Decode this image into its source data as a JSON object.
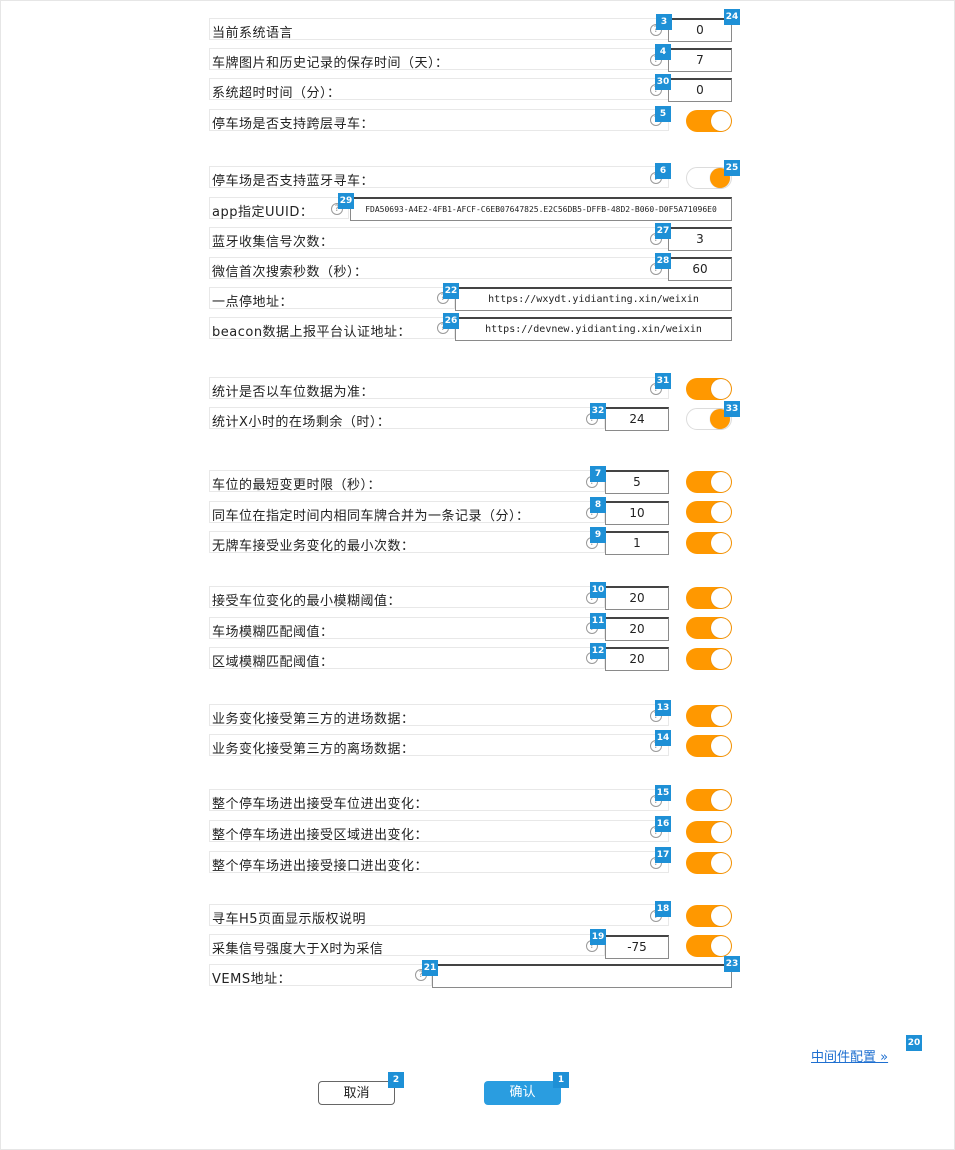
{
  "rows": [
    {
      "label": "当前系统语言"
    },
    {
      "label": "车牌图片和历史记录的保存时间（天）："
    },
    {
      "label": "系统超时时间（分）："
    },
    {
      "label": "停车场是否支持跨层寻车："
    },
    {
      "label": "停车场是否支持蓝牙寻车："
    },
    {
      "label": "app指定UUID："
    },
    {
      "label": "蓝牙收集信号次数："
    },
    {
      "label": "微信首次搜索秒数（秒）："
    },
    {
      "label": "一点停地址："
    },
    {
      "label": "beacon数据上报平台认证地址："
    },
    {
      "label": "统计是否以车位数据为准："
    },
    {
      "label": "统计X小时的在场剩余（时）："
    },
    {
      "label": "车位的最短变更时限（秒）："
    },
    {
      "label": "同车位在指定时间内相同车牌合并为一条记录（分）："
    },
    {
      "label": "无牌车接受业务变化的最小次数："
    },
    {
      "label": "接受车位变化的最小模糊阈值："
    },
    {
      "label": "车场模糊匹配阈值："
    },
    {
      "label": "区域模糊匹配阈值："
    },
    {
      "label": "业务变化接受第三方的进场数据："
    },
    {
      "label": "业务变化接受第三方的离场数据："
    },
    {
      "label": "整个停车场进出接受车位进出变化："
    },
    {
      "label": "整个停车场进出接受区域进出变化："
    },
    {
      "label": "整个停车场进出接受接口进出变化："
    },
    {
      "label": "寻车H5页面显示版权说明"
    },
    {
      "label": "采集信号强度大于X时为采信"
    },
    {
      "label": "VEMS地址："
    }
  ],
  "values": {
    "language": "0",
    "retention_days": "7",
    "timeout_min": "0",
    "uuid": "FDA50693-A4E2-4FB1-AFCF-C6EB07647825.E2C56DB5-DFFB-48D2-B060-D0F5A71096E0",
    "bt_count": "3",
    "wx_seconds": "60",
    "ydt_url": "https://wxydt.yidianting.xin/weixin",
    "beacon_url": "https://devnew.yidianting.xin/weixin",
    "stat_hours": "24",
    "min_change_sec": "5",
    "merge_min": "10",
    "unlicensed_min": "1",
    "space_fuzzy": "20",
    "lot_fuzzy": "20",
    "area_fuzzy": "20",
    "signal_threshold": "-75",
    "vems_url": ""
  },
  "toggles": {
    "cross_floor": true,
    "bluetooth": false,
    "stat_by_space": true,
    "stat_hours": false,
    "min_change": true,
    "merge": true,
    "unlicensed": true,
    "space_fuzzy": true,
    "lot_fuzzy": true,
    "area_fuzzy": true,
    "third_in": true,
    "third_out": true,
    "space_io": true,
    "area_io": true,
    "iface_io": true,
    "copyright": true,
    "signal": true
  },
  "badges": [
    "1",
    "2",
    "3",
    "4",
    "5",
    "6",
    "7",
    "8",
    "9",
    "10",
    "11",
    "12",
    "13",
    "14",
    "15",
    "16",
    "17",
    "18",
    "19",
    "20",
    "21",
    "22",
    "23",
    "24",
    "25",
    "26",
    "27",
    "28",
    "29",
    "30",
    "31",
    "32",
    "33"
  ],
  "help_glyph": "?",
  "buttons": {
    "cancel": "取消",
    "confirm": "确认"
  },
  "middleware_link": "中间件配置 »",
  "colors": {
    "toggle_on": "#ff9800",
    "primary": "#2a9de0",
    "badge": "#1e90d6",
    "link": "#1e6fd0"
  }
}
